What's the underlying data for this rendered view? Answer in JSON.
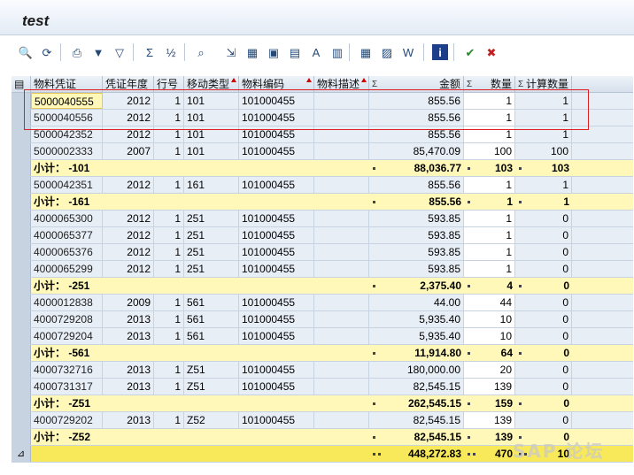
{
  "window": {
    "title": "test"
  },
  "toolbar": {
    "icons": [
      "details-icon",
      "refresh-icon",
      "print-icon",
      "set-filter-icon",
      "delete-filter-icon",
      "sum-icon",
      "subtotal-icon",
      "find-icon",
      "export-icon",
      "layout-icon",
      "save-layout-icon",
      "select-layout-icon",
      "abc-icon",
      "graphic-icon",
      "spreadsheet-icon",
      "local-file-icon",
      "word-icon",
      "info-icon",
      "confirm-icon",
      "cancel-icon"
    ]
  },
  "columns": {
    "doc": "物料凭证",
    "year": "凭证年度",
    "item": "行号",
    "mvt": "移动类型",
    "material": "物料编码",
    "desc": "物料描述",
    "amount": "金额",
    "qty": "数量",
    "calc": "计算数量",
    "sigma": "Σ"
  },
  "rows": [
    {
      "type": "data",
      "doc": "5000040555",
      "year": "2012",
      "item": "1",
      "mvt": "101",
      "material": "101000455",
      "amount": "855.56",
      "qty": "1",
      "calc": "1",
      "hl": true
    },
    {
      "type": "data",
      "doc": "5000040556",
      "year": "2012",
      "item": "1",
      "mvt": "101",
      "material": "101000455",
      "amount": "855.56",
      "qty": "1",
      "calc": "1"
    },
    {
      "type": "data",
      "doc": "5000042352",
      "year": "2012",
      "item": "1",
      "mvt": "101",
      "material": "101000455",
      "amount": "855.56",
      "qty": "1",
      "calc": "1"
    },
    {
      "type": "data",
      "doc": "5000002333",
      "year": "2007",
      "item": "1",
      "mvt": "101",
      "material": "101000455",
      "amount": "85,470.09",
      "qty": "100",
      "calc": "100"
    },
    {
      "type": "sub",
      "label": "小计： -101",
      "amount": "88,036.77",
      "qty": "103",
      "calc": "103"
    },
    {
      "type": "data",
      "doc": "5000042351",
      "year": "2012",
      "item": "1",
      "mvt": "161",
      "material": "101000455",
      "amount": "855.56",
      "qty": "1",
      "calc": "1"
    },
    {
      "type": "sub",
      "label": "小计： -161",
      "amount": "855.56",
      "qty": "1",
      "calc": "1"
    },
    {
      "type": "data",
      "doc": "4000065300",
      "year": "2012",
      "item": "1",
      "mvt": "251",
      "material": "101000455",
      "amount": "593.85",
      "qty": "1",
      "calc": "0"
    },
    {
      "type": "data",
      "doc": "4000065377",
      "year": "2012",
      "item": "1",
      "mvt": "251",
      "material": "101000455",
      "amount": "593.85",
      "qty": "1",
      "calc": "0"
    },
    {
      "type": "data",
      "doc": "4000065376",
      "year": "2012",
      "item": "1",
      "mvt": "251",
      "material": "101000455",
      "amount": "593.85",
      "qty": "1",
      "calc": "0"
    },
    {
      "type": "data",
      "doc": "4000065299",
      "year": "2012",
      "item": "1",
      "mvt": "251",
      "material": "101000455",
      "amount": "593.85",
      "qty": "1",
      "calc": "0"
    },
    {
      "type": "sub",
      "label": "小计： -251",
      "amount": "2,375.40",
      "qty": "4",
      "calc": "0"
    },
    {
      "type": "data",
      "doc": "4000012838",
      "year": "2009",
      "item": "1",
      "mvt": "561",
      "material": "101000455",
      "amount": "44.00",
      "qty": "44",
      "calc": "0"
    },
    {
      "type": "data",
      "doc": "4000729208",
      "year": "2013",
      "item": "1",
      "mvt": "561",
      "material": "101000455",
      "amount": "5,935.40",
      "qty": "10",
      "calc": "0"
    },
    {
      "type": "data",
      "doc": "4000729204",
      "year": "2013",
      "item": "1",
      "mvt": "561",
      "material": "101000455",
      "amount": "5,935.40",
      "qty": "10",
      "calc": "0"
    },
    {
      "type": "sub",
      "label": "小计： -561",
      "amount": "11,914.80",
      "qty": "64",
      "calc": "0"
    },
    {
      "type": "data",
      "doc": "4000732716",
      "year": "2013",
      "item": "1",
      "mvt": "Z51",
      "material": "101000455",
      "amount": "180,000.00",
      "qty": "20",
      "calc": "0"
    },
    {
      "type": "data",
      "doc": "4000731317",
      "year": "2013",
      "item": "1",
      "mvt": "Z51",
      "material": "101000455",
      "amount": "82,545.15",
      "qty": "139",
      "calc": "0"
    },
    {
      "type": "sub",
      "label": "小计： -Z51",
      "amount": "262,545.15",
      "qty": "159",
      "calc": "0"
    },
    {
      "type": "data",
      "doc": "4000729202",
      "year": "2013",
      "item": "1",
      "mvt": "Z52",
      "material": "101000455",
      "amount": "82,545.15",
      "qty": "139",
      "calc": "0"
    },
    {
      "type": "sub",
      "label": "小计： -Z52",
      "amount": "82,545.15",
      "qty": "139",
      "calc": "0"
    },
    {
      "type": "total",
      "amount": "448,272.83",
      "qty": "470",
      "calc": "10"
    }
  ],
  "watermark": "SAP 论坛"
}
